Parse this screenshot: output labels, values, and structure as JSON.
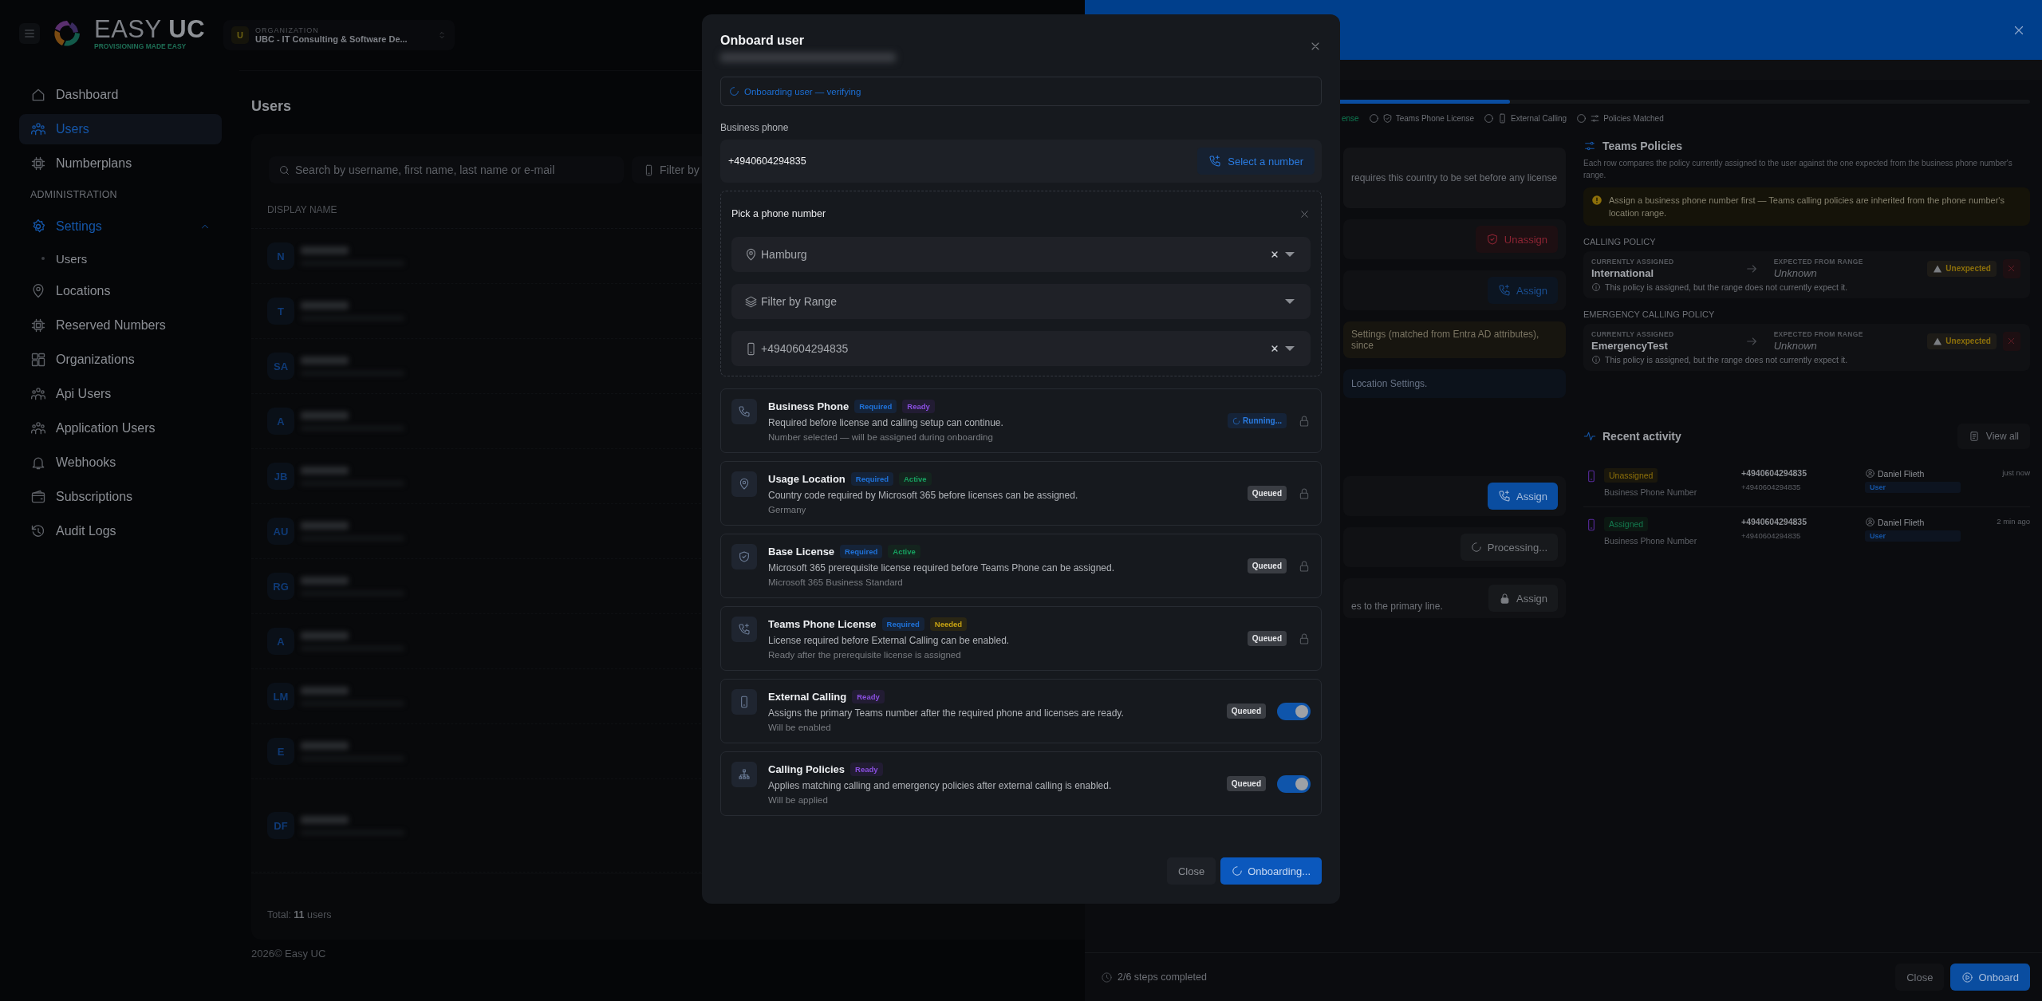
{
  "header": {
    "logo": "EASY **UC**",
    "tagline": "PROVISIONING MADE EASY"
  },
  "organization": {
    "avatar": "U",
    "label": "ORGANIZATION",
    "name": "UBC - IT Consulting & Software De..."
  },
  "sidebar": {
    "items": [
      {
        "label": "Dashboard",
        "selected": false
      },
      {
        "label": "Users",
        "selected": true
      },
      {
        "label": "Numberplans",
        "selected": false
      }
    ],
    "section": {
      "title": "ADMINISTRATION",
      "items": [
        {
          "label": "Settings",
          "selected": false,
          "expanded": true,
          "children": [
            {
              "label": "Users",
              "selected": false
            }
          ]
        },
        {
          "label": "Locations",
          "selected": false
        },
        {
          "label": "Reserved Numbers",
          "selected": false
        },
        {
          "label": "Organizations",
          "selected": false
        },
        {
          "label": "Api Users",
          "selected": false
        },
        {
          "label": "Application Users",
          "selected": false
        },
        {
          "label": "Webhooks",
          "selected": false
        },
        {
          "label": "Subscriptions",
          "selected": false
        },
        {
          "label": "Audit Logs",
          "selected": false
        }
      ]
    }
  },
  "users_page": {
    "title": "Users",
    "search": {
      "placeholder": "Search by username, first name, last name or e-mail"
    },
    "filter": {
      "placeholder": "Filter by"
    },
    "table": {
      "columns": [
        "DISPLAY NAME"
      ],
      "rows": [
        {
          "initials": "N"
        },
        {
          "initials": "T"
        },
        {
          "initials": "SA"
        },
        {
          "initials": "A"
        },
        {
          "initials": "JB"
        },
        {
          "initials": "AU"
        },
        {
          "initials": "RG"
        },
        {
          "initials": "A"
        },
        {
          "initials": "LM"
        },
        {
          "initials": "E"
        },
        {
          "initials": "DF"
        }
      ]
    },
    "total": "Total: **11** users",
    "footer": "2026© Easy UC"
  },
  "drawer": {
    "progress": {
      "level": 0.44
    },
    "steps": [
      {
        "label": "ense",
        "done": true
      },
      {
        "label": "Teams Phone License",
        "done": false
      },
      {
        "label": "External Calling",
        "done": false
      },
      {
        "label": "Policies Matched",
        "done": false
      }
    ],
    "rows": [
      {
        "kind": "note",
        "text": "requires this country to be set before any license"
      },
      {
        "kind": "danger",
        "label": "Unassign"
      },
      {
        "kind": "soft",
        "label": "Assign"
      },
      {
        "kind": "warning",
        "text": "Settings (matched from Entra AD attributes), since"
      },
      {
        "kind": "info",
        "text": "Location Settings."
      },
      {
        "kind": "primary",
        "label": "Assign"
      },
      {
        "kind": "loading",
        "label": "Processing..."
      },
      {
        "kind": "locked",
        "label": "Assign",
        "text": "es to the primary line."
      }
    ],
    "teams_policies": {
      "title": "Teams Policies",
      "description": "Each row compares the policy currently assigned to the user against the one expected from the business phone number's range.",
      "warning": "Assign a business phone number first — Teams calling policies are inherited from the phone number's location range.",
      "groups": [
        {
          "title": "CALLING POLICY",
          "assigned_label": "CURRENTLY ASSIGNED",
          "assigned": "International",
          "expected_label": "EXPECTED FROM RANGE",
          "expected": "Unknown",
          "badge": "Unexpected",
          "note": "This policy is assigned, but the range does not currently expect it."
        },
        {
          "title": "EMERGENCY CALLING POLICY",
          "assigned_label": "CURRENTLY ASSIGNED",
          "assigned": "EmergencyTest",
          "expected_label": "EXPECTED FROM RANGE",
          "expected": "Unknown",
          "badge": "Unexpected",
          "note": "This policy is assigned, but the range does not currently expect it."
        }
      ]
    },
    "recent_activity": {
      "title": "Recent activity",
      "button": "View all",
      "rows": [
        {
          "status": "Unassigned",
          "kind": "unassigned",
          "type": "Business Phone Number",
          "number": "+4940604294835",
          "sub_number": "+4940604294835",
          "user": "Daniel Flieth",
          "role": "User",
          "time": "just now"
        },
        {
          "status": "Assigned",
          "kind": "assigned",
          "type": "Business Phone Number",
          "number": "+4940604294835",
          "sub_number": "+4940604294835",
          "user": "Daniel Flieth",
          "role": "User",
          "time": "2 min ago"
        }
      ]
    },
    "footer": {
      "progress_text": "2/6 steps completed",
      "close": "Close",
      "primary": "Onboard"
    }
  },
  "modal": {
    "title": "Onboard user",
    "status": "Onboarding user — verifying",
    "business_phone": {
      "label": "Business phone",
      "value": "+4940604294835",
      "button": "Select a number"
    },
    "picker": {
      "title": "Pick a phone number",
      "fields": [
        {
          "value": "Hamburg",
          "clearable": true
        },
        {
          "placeholder": "Filter by Range",
          "clearable": false
        },
        {
          "value": "+4940604294835",
          "clearable": true
        }
      ]
    },
    "steps": [
      {
        "title": "Business Phone",
        "tags": [
          {
            "label": "Required",
            "kind": "required"
          },
          {
            "label": "Ready",
            "kind": "ready"
          }
        ],
        "description": "Required before license and calling setup can continue.",
        "detail": "Number selected — will be assigned during onboarding",
        "status": {
          "label": "Running...",
          "kind": "running"
        },
        "kind": "locked"
      },
      {
        "title": "Usage Location",
        "tags": [
          {
            "label": "Required",
            "kind": "required"
          },
          {
            "label": "Active",
            "kind": "active"
          }
        ],
        "description": "Country code required by Microsoft 365 before licenses can be assigned.",
        "detail": "Germany",
        "status": {
          "label": "Queued",
          "kind": "queued"
        },
        "kind": "locked"
      },
      {
        "title": "Base License",
        "tags": [
          {
            "label": "Required",
            "kind": "required"
          },
          {
            "label": "Active",
            "kind": "active"
          }
        ],
        "description": "Microsoft 365 prerequisite license required before Teams Phone can be assigned.",
        "detail": "Microsoft 365 Business Standard",
        "status": {
          "label": "Queued",
          "kind": "queued"
        },
        "kind": "locked"
      },
      {
        "title": "Teams Phone License",
        "tags": [
          {
            "label": "Required",
            "kind": "required"
          },
          {
            "label": "Needed",
            "kind": "needed"
          }
        ],
        "description": "License required before External Calling can be enabled.",
        "detail": "Ready after the prerequisite license is assigned",
        "status": {
          "label": "Queued",
          "kind": "queued"
        },
        "kind": "locked"
      },
      {
        "title": "External Calling",
        "tags": [
          {
            "label": "Ready",
            "kind": "ready"
          }
        ],
        "description": "Assigns the primary Teams number after the required phone and licenses are ready.",
        "detail": "Will be enabled",
        "status": {
          "label": "Queued",
          "kind": "queued"
        },
        "kind": "toggle",
        "on": true
      },
      {
        "title": "Calling Policies",
        "tags": [
          {
            "label": "Ready",
            "kind": "ready"
          }
        ],
        "description": "Applies matching calling and emergency policies after external calling is enabled.",
        "detail": "Will be applied",
        "status": {
          "label": "Queued",
          "kind": "queued"
        },
        "kind": "toggle",
        "on": true
      }
    ],
    "buttons": {
      "close": "Close",
      "primary": "Onboarding..."
    }
  }
}
